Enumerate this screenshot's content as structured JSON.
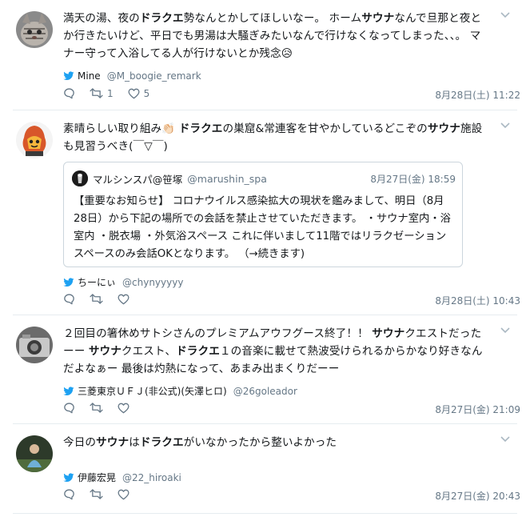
{
  "tweets": [
    {
      "segments": [
        "満天の湯、夜の",
        "ドラクエ",
        "勢なんとかしてほしいなー。 ホーム",
        "サウナ",
        "なんで旦那と夜とか行きたいけど、平日でも男湯は大騒ぎみたいなんで行けなくなってしまった、、。 マナー守って入浴してる人が行けないとか残念"
      ],
      "emoji": "😥",
      "via_user": "Mine",
      "via_handle": "@M_boogie_remark",
      "retweets": "1",
      "likes": "5",
      "date": "8月28日(土) 11:22"
    },
    {
      "segments": [
        "素晴らしい取り組み",
        "👏🏻",
        " ",
        "ドラクエ",
        "の巣窟&常連客を甘やかしているどこぞの",
        "サウナ",
        "施設も見習うべき(￣▽￣)"
      ],
      "quote": {
        "name": "マルシンスパ@笹塚",
        "handle": "@marushin_spa",
        "date": "8月27日(金) 18:59",
        "text": "【重要なお知らせ】 コロナウイルス感染拡大の現状を鑑みまして、明日（8月28日）から下記の場所での会話を禁止させていただきます。 ・サウナ室内・浴室内 ・脱衣場 ・外気浴スペース これに伴いまして11階ではリラクゼーションスペースのみ会話OKとなります。 （→続きます)"
      },
      "via_user": "ちーにぃ",
      "via_handle": "@chynyyyyy",
      "date": "8月28日(土) 10:43"
    },
    {
      "segments": [
        "２回目の箸休めサトシさんのプレミアムアウフグース終了！！ ",
        "サウナ",
        "クエストだったーー ",
        "サウナ",
        "クエスト、",
        "ドラクエ",
        "１の音楽に載せて熱波受けられるからかなり好きなんだよなぁー 最後は灼熱になって、あまみ出まくりだーー"
      ],
      "via_user": "三菱東京ＵＦＪ(非公式)(矢澤ヒロ)",
      "via_handle": "@26goleador",
      "date": "8月27日(金) 21:09"
    },
    {
      "segments": [
        "今日の",
        "サウナ",
        "は",
        "ドラクエ",
        "がいなかったから整いよかった"
      ],
      "via_user": "伊藤宏晃",
      "via_handle": "@22_hiroaki",
      "date": "8月27日(金) 20:43"
    }
  ],
  "colors": {
    "twitter_blue": "#1da1f2",
    "muted": "#657786",
    "border": "#e6ecf0",
    "text": "#14171a"
  },
  "icons": [
    "reply-icon",
    "retweet-icon",
    "like-icon",
    "caret-down-icon",
    "twitter-bird-icon"
  ]
}
